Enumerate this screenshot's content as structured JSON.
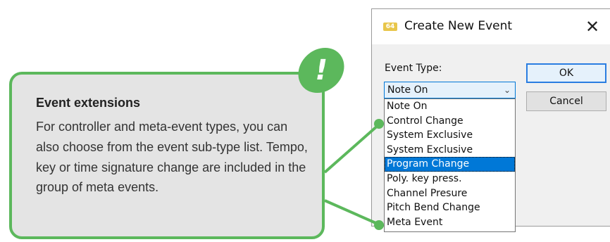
{
  "dialog": {
    "app_icon": "64",
    "title": "Create New Event",
    "close_glyph": "✕",
    "event_type_label": "Event Type:",
    "ok_label": "OK",
    "cancel_label": "Cancel",
    "selected_value": "Note On",
    "options": [
      "Note On",
      "Control Change",
      "System Exclusive",
      "System Exclusive",
      "Program Change",
      "Poly. key press.",
      "Channel Presure",
      "Pitch Bend Change",
      "Meta Event"
    ],
    "highlighted_option": "Program Change"
  },
  "callout": {
    "badge": "!",
    "title": "Event extensions",
    "body": "For controller and meta-event types, you can also choose from the event sub-type list. Tempo, key or time signature change are included in the group of meta events.",
    "accent_color": "#5cb85c"
  }
}
